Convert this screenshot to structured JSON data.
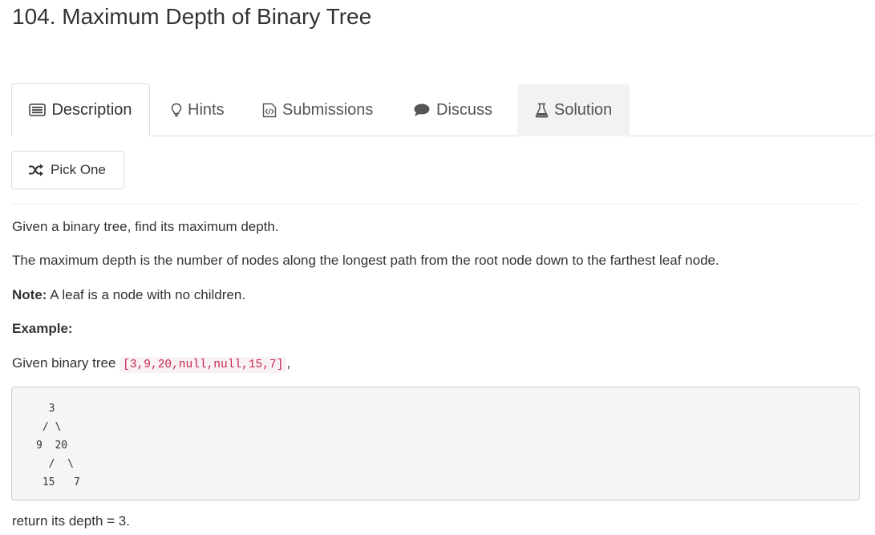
{
  "problem": {
    "title": "104. Maximum Depth of Binary Tree"
  },
  "tabs": [
    {
      "label": "Description",
      "icon": "list-icon"
    },
    {
      "label": "Hints",
      "icon": "lightbulb-icon"
    },
    {
      "label": "Submissions",
      "icon": "code-file-icon"
    },
    {
      "label": "Discuss",
      "icon": "chat-bubble-icon"
    },
    {
      "label": "Solution",
      "icon": "flask-icon"
    }
  ],
  "pick_one": {
    "label": "Pick One",
    "icon": "shuffle-icon"
  },
  "description": {
    "p1": "Given a binary tree, find its maximum depth.",
    "p2": "The maximum depth is the number of nodes along the longest path from the root node down to the farthest leaf node.",
    "note_label": "Note:",
    "note_text": " A leaf is a node with no children.",
    "example_label": "Example:",
    "given_prefix": "Given binary tree ",
    "given_code": "[3,9,20,null,null,15,7]",
    "given_suffix": ",",
    "tree": "  3\n / \\\n9  20\n  /  \\\n 15   7",
    "result": "return its depth = 3."
  },
  "colors": {
    "code_text": "#c7254e",
    "code_bg": "#f9f2f4",
    "active_tab_border": "#dddddd",
    "solution_tab_bg": "#f2f2f2"
  }
}
